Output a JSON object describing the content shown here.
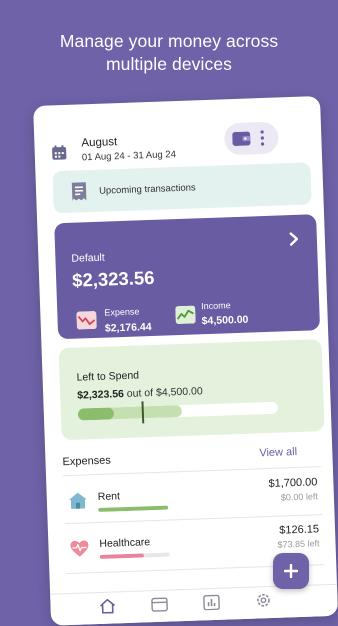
{
  "headline": {
    "line1": "Manage your money across",
    "line2": "multiple devices"
  },
  "header": {
    "month": "August",
    "range": "01 Aug 24 - 31 Aug 24",
    "calendar_icon": "calendar-icon",
    "wallet_icon": "wallet-icon",
    "more_icon": "more-vertical-icon"
  },
  "upcoming": {
    "label": "Upcoming transactions",
    "icon": "receipt-icon"
  },
  "balance": {
    "account": "Default",
    "amount": "$2,323.56",
    "expense_label": "Expense",
    "expense_value": "$2,176.44",
    "income_label": "Income",
    "income_value": "$4,500.00"
  },
  "spend": {
    "title": "Left to Spend",
    "amount": "$2,323.56",
    "out_of": " out of ",
    "total": "$4,500.00",
    "progress": 0.52,
    "spent_progress": 0.18,
    "today_marker": 0.32
  },
  "expenses": {
    "title": "Expenses",
    "view_all": "View all",
    "items": [
      {
        "name": "Rent",
        "amount": "$1,700.00",
        "left": "$0.00 left",
        "progress": 1.0,
        "color": "#8cbd6c",
        "icon": "house-icon"
      },
      {
        "name": "Healthcare",
        "amount": "$126.15",
        "left": "$73.85 left",
        "progress": 0.63,
        "color": "#e8839a",
        "icon": "heartbeat-icon"
      }
    ]
  },
  "nav": {
    "items": [
      "home-icon",
      "calendar-icon",
      "chart-icon",
      "settings-icon"
    ]
  },
  "colors": {
    "background": "#6f62a8",
    "card_purple": "#6a5ca3",
    "card_green": "#e4f1dc",
    "upcoming_teal": "#e3f1ef",
    "accent_green": "#8cbd6c"
  }
}
